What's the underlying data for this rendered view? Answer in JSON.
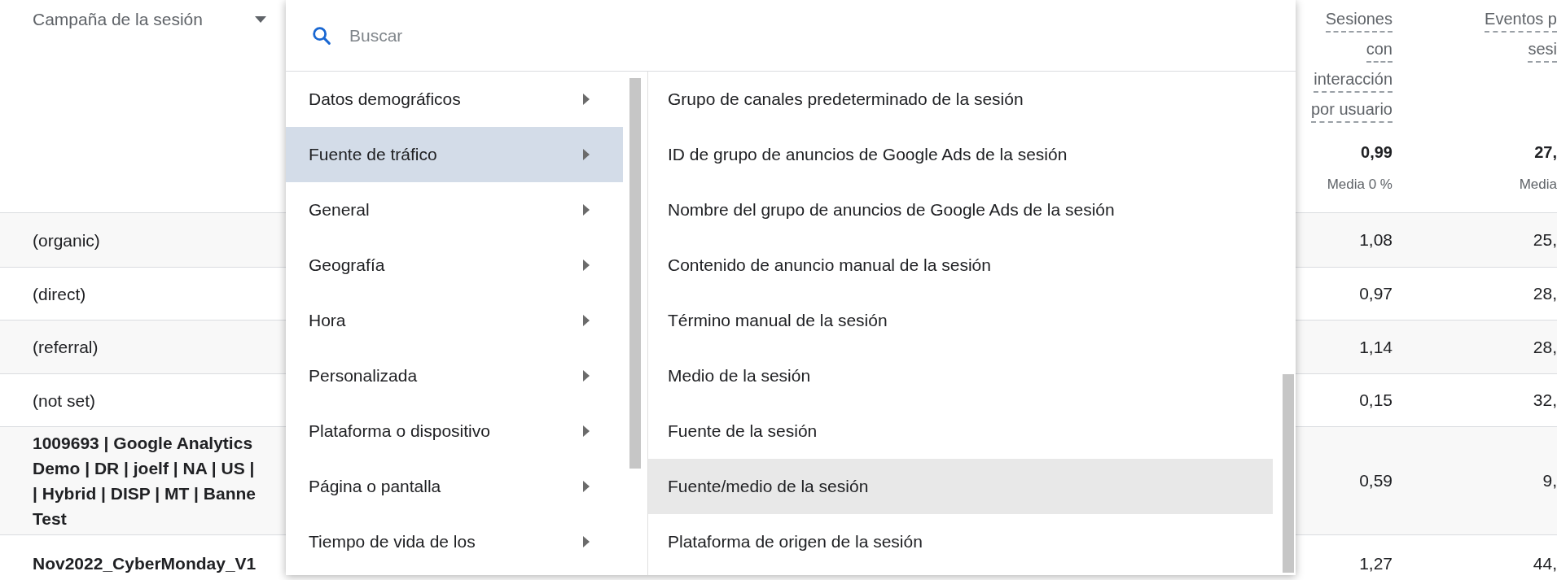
{
  "table": {
    "dimension_header": "Campaña de la sesión",
    "columns": [
      {
        "lines": [
          "Sesiones",
          "con",
          "interacción",
          "por usuario"
        ],
        "total": "0,99",
        "total_note": "Media 0 %"
      },
      {
        "lines": [
          "Eventos p",
          "sesi"
        ],
        "total": "27,",
        "total_note": "Media"
      }
    ],
    "rows": [
      {
        "dimension": [
          "(organic)"
        ],
        "values": [
          "1,08",
          "25,"
        ]
      },
      {
        "dimension": [
          "(direct)"
        ],
        "values": [
          "0,97",
          "28,"
        ]
      },
      {
        "dimension": [
          "(referral)"
        ],
        "values": [
          "1,14",
          "28,"
        ]
      },
      {
        "dimension": [
          "(not set)"
        ],
        "values": [
          "0,15",
          "32,"
        ]
      },
      {
        "dimension": [
          "1009693 | Google Analytics",
          "Demo | DR | joelf | NA | US |",
          "| Hybrid | DISP | MT | Banne",
          "Test"
        ],
        "values": [
          "0,59",
          "9,"
        ]
      },
      {
        "dimension": [
          "Nov2022_CyberMonday_V1"
        ],
        "values": [
          "1,27",
          "44,"
        ]
      }
    ]
  },
  "dimension_picker": {
    "search": {
      "placeholder": "Buscar"
    },
    "categories": [
      {
        "label": "Datos demográficos",
        "selected": false
      },
      {
        "label": "Fuente de tráfico",
        "selected": true
      },
      {
        "label": "General",
        "selected": false
      },
      {
        "label": "Geografía",
        "selected": false
      },
      {
        "label": "Hora",
        "selected": false
      },
      {
        "label": "Personalizada",
        "selected": false
      },
      {
        "label": "Plataforma o dispositivo",
        "selected": false
      },
      {
        "label": "Página o pantalla",
        "selected": false
      },
      {
        "label": "Tiempo de vida de los",
        "selected": false
      }
    ],
    "options": [
      {
        "label": "Grupo de canales predeterminado de la sesión",
        "highlighted": false
      },
      {
        "label": "ID de grupo de anuncios de Google Ads de la sesión",
        "highlighted": false
      },
      {
        "label": "Nombre del grupo de anuncios de Google Ads de la sesión",
        "highlighted": false
      },
      {
        "label": "Contenido de anuncio manual de la sesión",
        "highlighted": false
      },
      {
        "label": "Término manual de la sesión",
        "highlighted": false
      },
      {
        "label": "Medio de la sesión",
        "highlighted": false
      },
      {
        "label": "Fuente de la sesión",
        "highlighted": false
      },
      {
        "label": "Fuente/medio de la sesión",
        "highlighted": true
      },
      {
        "label": "Plataforma de origen de la sesión",
        "highlighted": false
      }
    ]
  }
}
